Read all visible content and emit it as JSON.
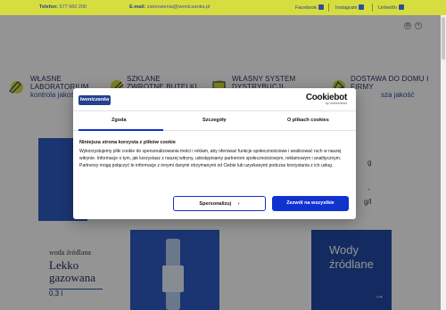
{
  "topbar": {
    "phone_label": "Telefon:",
    "phone_value": "577 660 200",
    "email_label": "E-mail:",
    "email_value": "zamowienia@iwoniczanka.pl",
    "social": [
      {
        "label": "Facebook",
        "icon": "facebook-icon"
      },
      {
        "label": "Instagram",
        "icon": "instagram-icon"
      },
      {
        "label": "LinkedIn",
        "icon": "linkedin-icon"
      }
    ],
    "colors": {
      "bar": "#d6dd3f",
      "text": "#24408f"
    }
  },
  "features": [
    {
      "title": "WŁASNE LABORATORIUM",
      "subtitle": "kontrola jakości",
      "icon": "laboratory-icon"
    },
    {
      "title": "SZKLANE ZWROTNE BUTELKI",
      "subtitle": "",
      "icon": "bottle-icon"
    },
    {
      "title": "WŁASNY SYSTEM DYSTRYBUCJI",
      "subtitle": "",
      "icon": "truck-icon"
    },
    {
      "title": "DOSTAWA DO DOMU I FIRMY",
      "subtitle": "sza jakość",
      "icon": "delivery-icon"
    }
  ],
  "product": {
    "kind": "woda źródlana",
    "name_line1": "Lekko",
    "name_line2": "gazowana",
    "volume": "0,3 l"
  },
  "right_card": {
    "title_line1": "Wody",
    "title_line2": "źródlane",
    "arrow": "→"
  },
  "partial_right": {
    "line1": "g",
    "line2": "-",
    "line3": "g/l"
  },
  "cookie": {
    "brand_logo": "Iwoniczanka",
    "provider": "Cookiebot",
    "provider_sub": "by Usercentrics",
    "tabs": [
      "Zgoda",
      "Szczegóły",
      "O plikach cookies"
    ],
    "title": "Niniejsza strona korzysta z plików cookie",
    "body": "Wykorzystujemy pliki cookie do spersonalizowania treści i reklam, aby oferować funkcje społecznościowe i analizować ruch w naszej witrynie. Informacje o tym, jak korzystasz z naszej witryny, udostępniamy partnerom społecznościowym, reklamowym i analitycznym. Partnerzy mogą połączyć te informacje z innymi danymi otrzymanymi od Ciebie lub uzyskanymi podczas korzystania z ich usług.",
    "btn_personalize": "Spersonalizuj",
    "btn_personalize_arrow": "›",
    "btn_allow": "Zezwól na wszystkie",
    "accent": "#1032cf"
  }
}
